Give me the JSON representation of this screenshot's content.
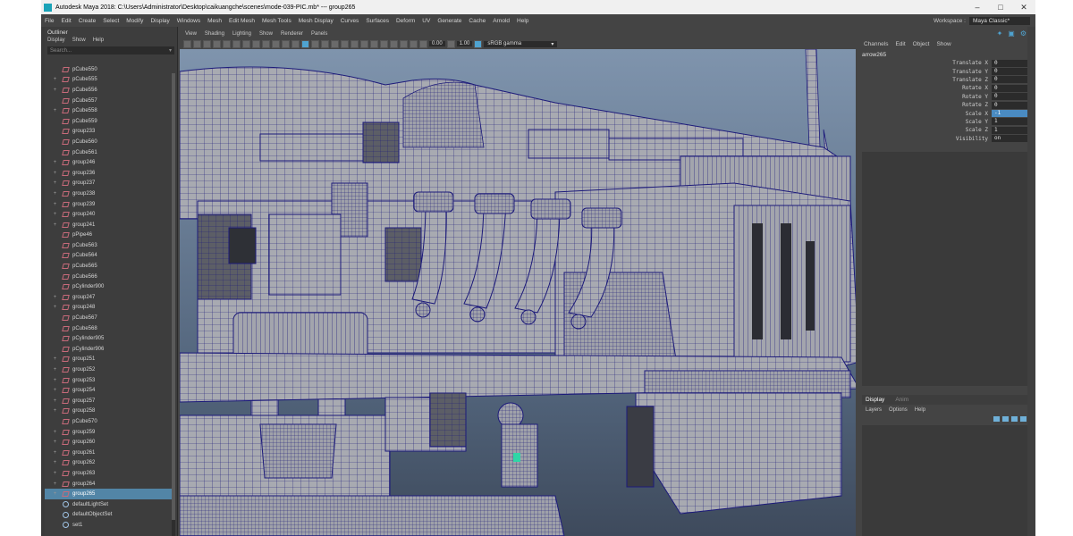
{
  "window": {
    "title": "Autodesk Maya 2018: C:\\Users\\Administrator\\Desktop\\caikuangche\\scenes\\mode-039-PIC.mb*   ---   group265",
    "controls": [
      "–",
      "□",
      "✕"
    ]
  },
  "menubar": {
    "items": [
      "File",
      "Edit",
      "Create",
      "Select",
      "Modify",
      "Display",
      "Windows",
      "Mesh",
      "Edit Mesh",
      "Mesh Tools",
      "Mesh Display",
      "Curves",
      "Surfaces",
      "Deform",
      "UV",
      "Generate",
      "Cache",
      "Arnold",
      "Help"
    ],
    "workspace_label": "Workspace :",
    "workspace_value": "Maya Classic*"
  },
  "outliner": {
    "title": "Outliner",
    "menu": [
      "Display",
      "Show",
      "Help"
    ],
    "search_placeholder": "Search...",
    "items": [
      {
        "name": "pCube550",
        "type": "mesh",
        "exp": ""
      },
      {
        "name": "pCube555",
        "type": "mesh",
        "exp": "+"
      },
      {
        "name": "pCube556",
        "type": "mesh",
        "exp": "+"
      },
      {
        "name": "pCube557",
        "type": "mesh",
        "exp": ""
      },
      {
        "name": "pCube558",
        "type": "mesh",
        "exp": "+"
      },
      {
        "name": "pCube559",
        "type": "mesh",
        "exp": ""
      },
      {
        "name": "group233",
        "type": "mesh",
        "exp": ""
      },
      {
        "name": "pCube560",
        "type": "mesh",
        "exp": ""
      },
      {
        "name": "pCube561",
        "type": "mesh",
        "exp": ""
      },
      {
        "name": "group246",
        "type": "mesh",
        "exp": "+"
      },
      {
        "name": "group236",
        "type": "mesh",
        "exp": "+"
      },
      {
        "name": "group237",
        "type": "mesh",
        "exp": "+"
      },
      {
        "name": "group238",
        "type": "mesh",
        "exp": "+"
      },
      {
        "name": "group239",
        "type": "mesh",
        "exp": "+"
      },
      {
        "name": "group240",
        "type": "mesh",
        "exp": "+"
      },
      {
        "name": "group241",
        "type": "mesh",
        "exp": "+"
      },
      {
        "name": "pPipe46",
        "type": "mesh",
        "exp": ""
      },
      {
        "name": "pCube563",
        "type": "mesh",
        "exp": ""
      },
      {
        "name": "pCube564",
        "type": "mesh",
        "exp": ""
      },
      {
        "name": "pCube565",
        "type": "mesh",
        "exp": ""
      },
      {
        "name": "pCube566",
        "type": "mesh",
        "exp": ""
      },
      {
        "name": "pCylinder900",
        "type": "mesh",
        "exp": ""
      },
      {
        "name": "group247",
        "type": "mesh",
        "exp": "+"
      },
      {
        "name": "group248",
        "type": "mesh",
        "exp": "+"
      },
      {
        "name": "pCube567",
        "type": "mesh",
        "exp": ""
      },
      {
        "name": "pCube568",
        "type": "mesh",
        "exp": ""
      },
      {
        "name": "pCylinder905",
        "type": "mesh",
        "exp": ""
      },
      {
        "name": "pCylinder906",
        "type": "mesh",
        "exp": ""
      },
      {
        "name": "group251",
        "type": "mesh",
        "exp": "+"
      },
      {
        "name": "group252",
        "type": "mesh",
        "exp": "+"
      },
      {
        "name": "group253",
        "type": "mesh",
        "exp": "+"
      },
      {
        "name": "group254",
        "type": "mesh",
        "exp": "+"
      },
      {
        "name": "group257",
        "type": "mesh",
        "exp": "+"
      },
      {
        "name": "group258",
        "type": "mesh",
        "exp": "+"
      },
      {
        "name": "pCube570",
        "type": "mesh",
        "exp": ""
      },
      {
        "name": "group259",
        "type": "mesh",
        "exp": "+"
      },
      {
        "name": "group260",
        "type": "mesh",
        "exp": "+"
      },
      {
        "name": "group261",
        "type": "mesh",
        "exp": "+"
      },
      {
        "name": "group262",
        "type": "mesh",
        "exp": "+"
      },
      {
        "name": "group263",
        "type": "mesh",
        "exp": "+"
      },
      {
        "name": "group264",
        "type": "mesh",
        "exp": "+"
      },
      {
        "name": "group265",
        "type": "mesh",
        "exp": "+",
        "selected": true
      },
      {
        "name": "defaultLightSet",
        "type": "set",
        "exp": ""
      },
      {
        "name": "defaultObjectSet",
        "type": "set",
        "exp": ""
      },
      {
        "name": "set1",
        "type": "set",
        "exp": ""
      }
    ]
  },
  "viewport": {
    "menu": [
      "View",
      "Shading",
      "Lighting",
      "Show",
      "Renderer",
      "Panels"
    ],
    "exposure": "0.00",
    "gamma": "1.00",
    "color_space": "sRGB gamma"
  },
  "channel_box": {
    "menu": [
      "Channels",
      "Edit",
      "Object",
      "Show"
    ],
    "object_name": "arrow265",
    "attributes": [
      {
        "label": "Translate X",
        "value": "0"
      },
      {
        "label": "Translate Y",
        "value": "0"
      },
      {
        "label": "Translate Z",
        "value": "0"
      },
      {
        "label": "Rotate X",
        "value": "0"
      },
      {
        "label": "Rotate Y",
        "value": "0"
      },
      {
        "label": "Rotate Z",
        "value": "0"
      },
      {
        "label": "Scale X",
        "value": "-1",
        "highlight": true
      },
      {
        "label": "Scale Y",
        "value": "1"
      },
      {
        "label": "Scale Z",
        "value": "1"
      },
      {
        "label": "Visibility",
        "value": "on"
      }
    ]
  },
  "layer_editor": {
    "tabs": [
      "Display",
      "Anim"
    ],
    "menu": [
      "Layers",
      "Options",
      "Help"
    ]
  },
  "colors": {
    "selection": "#5285a6",
    "accent": "#4fa3d0",
    "wireframe": "#1c1a7a",
    "mesh_gray": "#a7a9b0"
  }
}
